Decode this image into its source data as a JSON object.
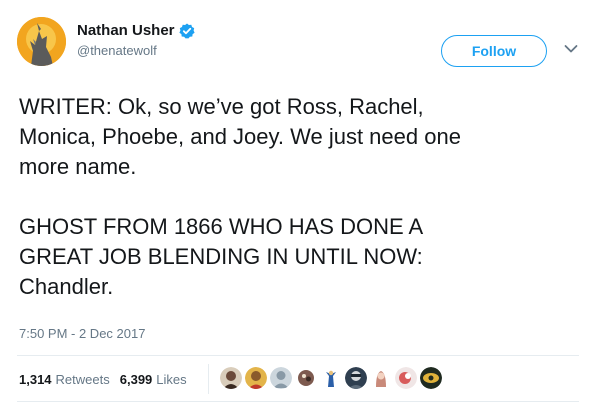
{
  "author": {
    "display_name": "Nathan Usher",
    "handle": "@thenatewolf",
    "verified_icon": "verified-badge-icon",
    "avatar_icon": "howling-wolf-avatar"
  },
  "follow_label": "Follow",
  "menu_icon": "chevron-down-icon",
  "tweet": {
    "line1": "WRITER: Ok, so we’ve got Ross, Rachel,",
    "line2": "Monica, Phoebe, and Joey. We just need one",
    "line3": "more name.",
    "line4": "GHOST FROM 1866 WHO HAS DONE A",
    "line5": "GREAT JOB BLENDING IN UNTIL NOW:",
    "line6": "Chandler."
  },
  "timestamp": "7:50 PM - 2 Dec 2017",
  "stats": {
    "retweets_count": "1,314",
    "retweets_label": "Retweets",
    "likes_count": "6,399",
    "likes_label": "Likes"
  },
  "colors": {
    "accent": "#1da1f2",
    "secondary_text": "#657786",
    "primary_text": "#14171a",
    "divider": "#e6ecf0"
  }
}
